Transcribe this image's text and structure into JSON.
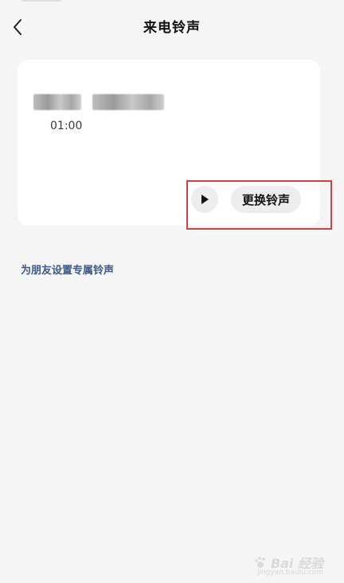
{
  "header": {
    "title": "来电铃声",
    "back_icon": "chevron-left-icon"
  },
  "ringtone_card": {
    "duration": "01:00",
    "play_icon": "play-icon",
    "change_label": "更换铃声"
  },
  "friend_link": "为朋友设置专属铃声",
  "watermark": {
    "text": "Bai 经验",
    "sub": "jingyan.baidu.com"
  },
  "colors": {
    "background": "#f5f5f5",
    "card": "#ffffff",
    "link": "#3e5a86",
    "highlight": "#d14040"
  }
}
